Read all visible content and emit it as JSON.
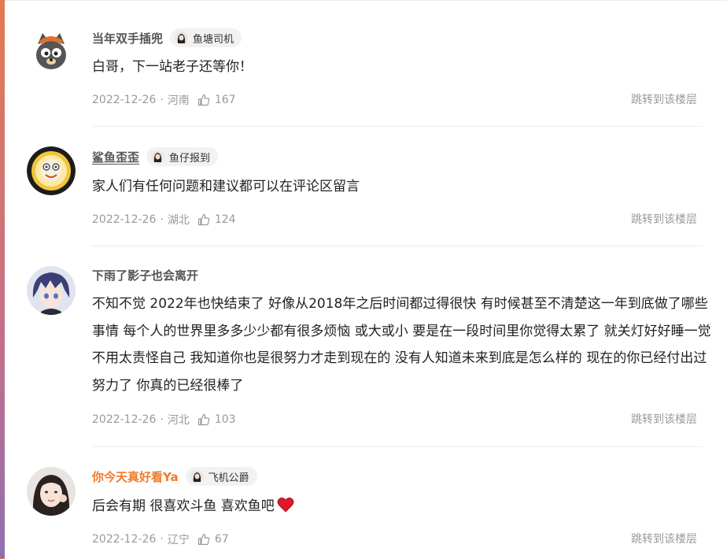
{
  "comments": [
    {
      "username": "当年双手插兜",
      "badge": "鱼塘司机",
      "text": "白哥，下一站老子还等你！",
      "date": "2022-12-26",
      "location": "河南",
      "likes": "167",
      "jump_label": "跳转到该楼层"
    },
    {
      "username": "鲨鱼歪歪",
      "badge": "鱼仔报到",
      "text": "家人们有任何问题和建议都可以在评论区留言",
      "date": "2022-12-26",
      "location": "湖北",
      "likes": "124",
      "jump_label": "跳转到该楼层"
    },
    {
      "username": "下雨了影子也会离开",
      "text": "不知不觉 2022年也快结束了 好像从2018年之后时间都过得很快 有时候甚至不清楚这一年到底做了哪些事情 每个人的世界里多多少少都有很多烦恼 或大或小 要是在一段时间里你觉得太累了 就关灯好好睡一觉 不用太责怪自己 我知道你也是很努力才走到现在的 没有人知道未来到底是怎么样的 现在的你已经付出过努力了 你真的已经很棒了",
      "date": "2022-12-26",
      "location": "河北",
      "likes": "103",
      "jump_label": "跳转到该楼层"
    },
    {
      "username": "你今天真好看Ya",
      "badge": "飞机公爵",
      "text": "后会有期 很喜欢斗鱼 喜欢鱼吧",
      "date": "2022-12-26",
      "location": "辽宁",
      "likes": "67",
      "jump_label": "跳转到该楼层"
    }
  ],
  "separator": "·",
  "colors": {
    "username": "#555555",
    "username_highlight": "#f07a2a",
    "meta": "#999999",
    "heart": "#e0182c"
  }
}
